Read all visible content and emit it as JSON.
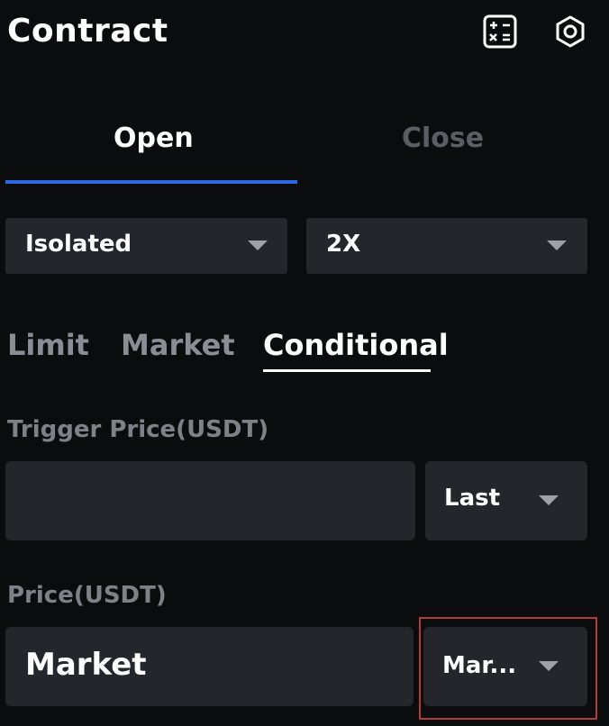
{
  "header": {
    "title": "Contract",
    "icons": [
      "calculator-icon",
      "settings-icon"
    ]
  },
  "position_tabs": [
    {
      "label": "Open",
      "active": true
    },
    {
      "label": "Close",
      "active": false
    }
  ],
  "margin_mode": {
    "value": "Isolated"
  },
  "leverage": {
    "value": "2X"
  },
  "order_types": [
    {
      "label": "Limit",
      "active": false
    },
    {
      "label": "Market",
      "active": false
    },
    {
      "label": "Conditional",
      "active": true
    }
  ],
  "trigger_price": {
    "label": "Trigger Price(USDT)",
    "value": "",
    "type_select": "Last"
  },
  "price": {
    "label": "Price(USDT)",
    "value": "Market",
    "type_select": "Mar..."
  },
  "colors": {
    "background": "#0b0c0e",
    "accent": "#2f6ae4",
    "field": "#24262b",
    "highlight_border": "#b23a3a"
  }
}
